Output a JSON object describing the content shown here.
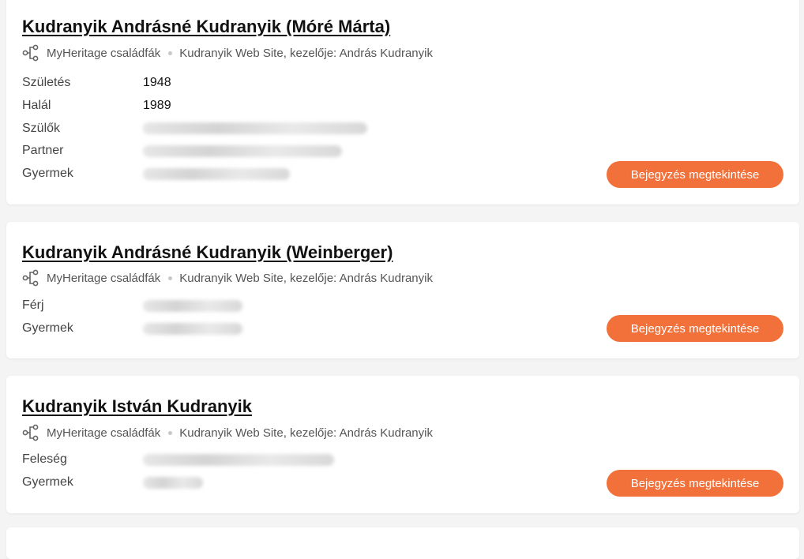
{
  "records": [
    {
      "name": "Kudranyik Andrásné Kudranyik (Móré Márta)",
      "source": "MyHeritage családfák",
      "site": "Kudranyik Web Site, kezelője: András Kudranyik",
      "fields": [
        {
          "label": "Születés",
          "value": "1948"
        },
        {
          "label": "Halál",
          "value": "1989"
        },
        {
          "label": "Szülők",
          "value": ""
        },
        {
          "label": "Partner",
          "value": ""
        },
        {
          "label": "Gyermek",
          "value": ""
        }
      ],
      "button_label": "Bejegyzés megtekintése"
    },
    {
      "name": "Kudranyik Andrásné Kudranyik (Weinberger)",
      "source": "MyHeritage családfák",
      "site": "Kudranyik Web Site, kezelője: András Kudranyik",
      "fields": [
        {
          "label": "Férj",
          "value": ""
        },
        {
          "label": "Gyermek",
          "value": ""
        }
      ],
      "button_label": "Bejegyzés megtekintése"
    },
    {
      "name": "Kudranyik István Kudranyik",
      "source": "MyHeritage családfák",
      "site": "Kudranyik Web Site, kezelője: András Kudranyik",
      "fields": [
        {
          "label": "Feleség",
          "value": ""
        },
        {
          "label": "Gyermek",
          "value": ""
        }
      ],
      "button_label": "Bejegyzés megtekintése"
    }
  ],
  "colors": {
    "accent": "#f2713a",
    "background": "#f4f4f4",
    "card": "#ffffff"
  },
  "icons": {
    "source": "family-tree-icon"
  }
}
